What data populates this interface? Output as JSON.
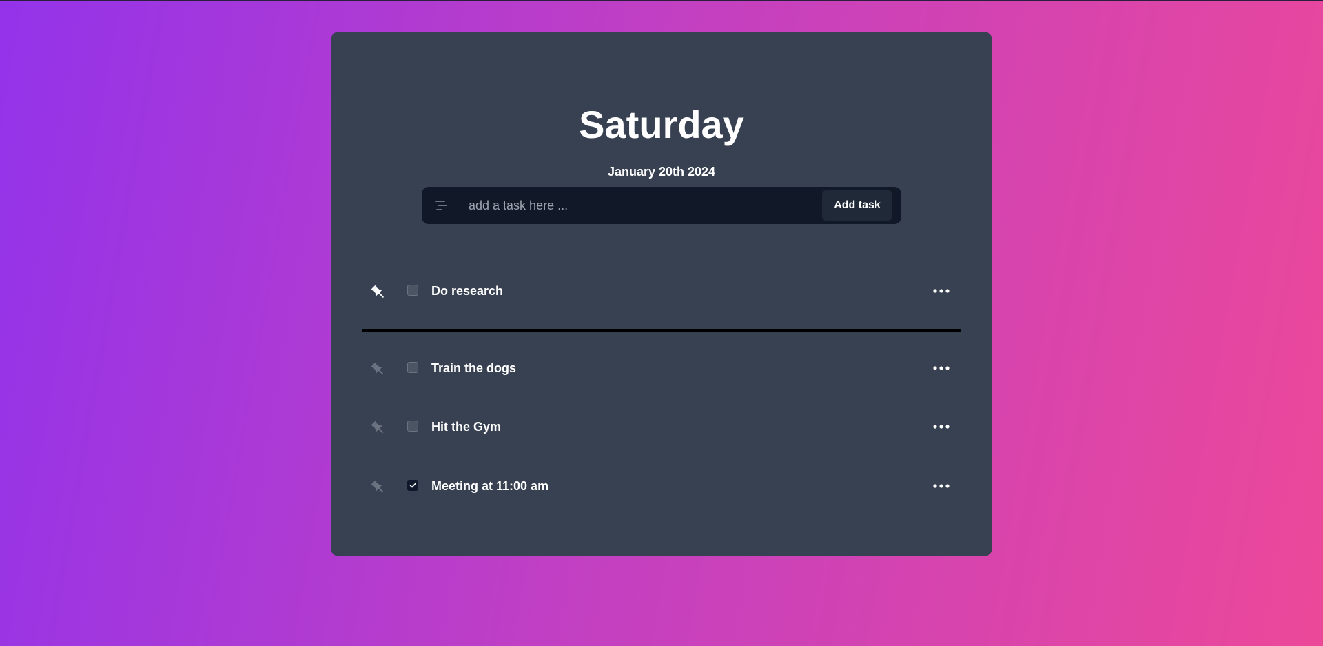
{
  "header": {
    "day": "Saturday",
    "date": "January 20th 2024"
  },
  "form": {
    "placeholder": "add a task here ...",
    "value": "",
    "add_label": "Add task",
    "menu_icon": "lines-icon"
  },
  "colors": {
    "background_start": "#9333ea",
    "background_end": "#ec4899",
    "card": "#374151",
    "form": "#111827",
    "button": "#1f2937"
  },
  "pinned_tasks": [
    {
      "label": "Do research",
      "pinned": true,
      "done": false
    }
  ],
  "tasks": [
    {
      "label": "Train the dogs",
      "pinned": false,
      "done": false
    },
    {
      "label": "Hit the Gym",
      "pinned": false,
      "done": false
    },
    {
      "label": "Meeting at 11:00 am",
      "pinned": false,
      "done": true
    }
  ]
}
